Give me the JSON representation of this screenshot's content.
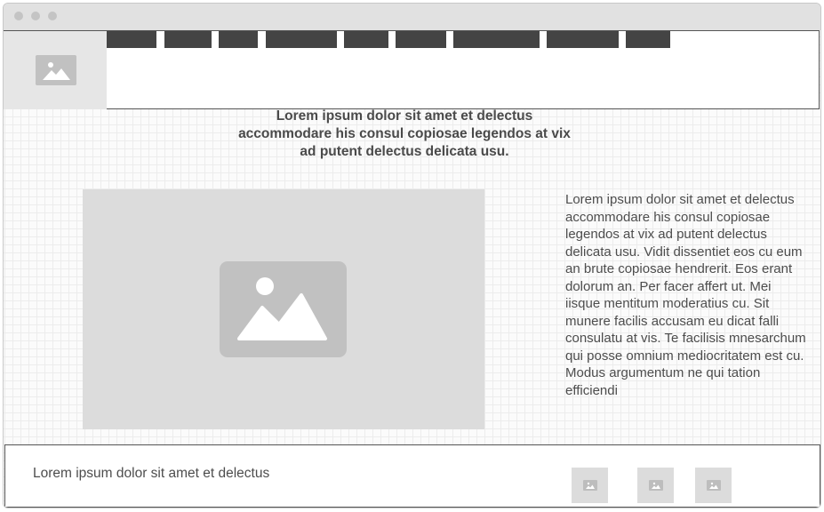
{
  "colors": {
    "nav_block": "#444444",
    "placeholder": "#dcdcdc",
    "placeholder_icon": "#c1c1c1",
    "text": "#4d4d4d"
  },
  "icons": {
    "logo": "image-placeholder-icon",
    "hero": "image-placeholder-icon",
    "thumbnails": "image-placeholder-icon"
  },
  "header": {
    "nav_items": 9
  },
  "main": {
    "headline": "Lorem ipsum dolor sit amet et delectus accommodare his consul copiosae legendos at vix ad putent delectus delicata usu.",
    "body": "Lorem ipsum dolor sit amet et delectus accommodare his consul copiosae legendos at vix ad putent delectus delicata usu. Vidit dissentiet eos cu eum an brute copiosae hendrerit. Eos erant dolorum an. Per facer affert ut. Mei iisque mentitum moderatius cu. Sit munere facilis accusam eu dicat falli consulatu at vis. Te facilisis mnesarchum qui posse omnium mediocritatem est cu. Modus argumentum ne qui tation efficiendi"
  },
  "footer": {
    "text": "Lorem ipsum dolor sit amet et delectus"
  }
}
